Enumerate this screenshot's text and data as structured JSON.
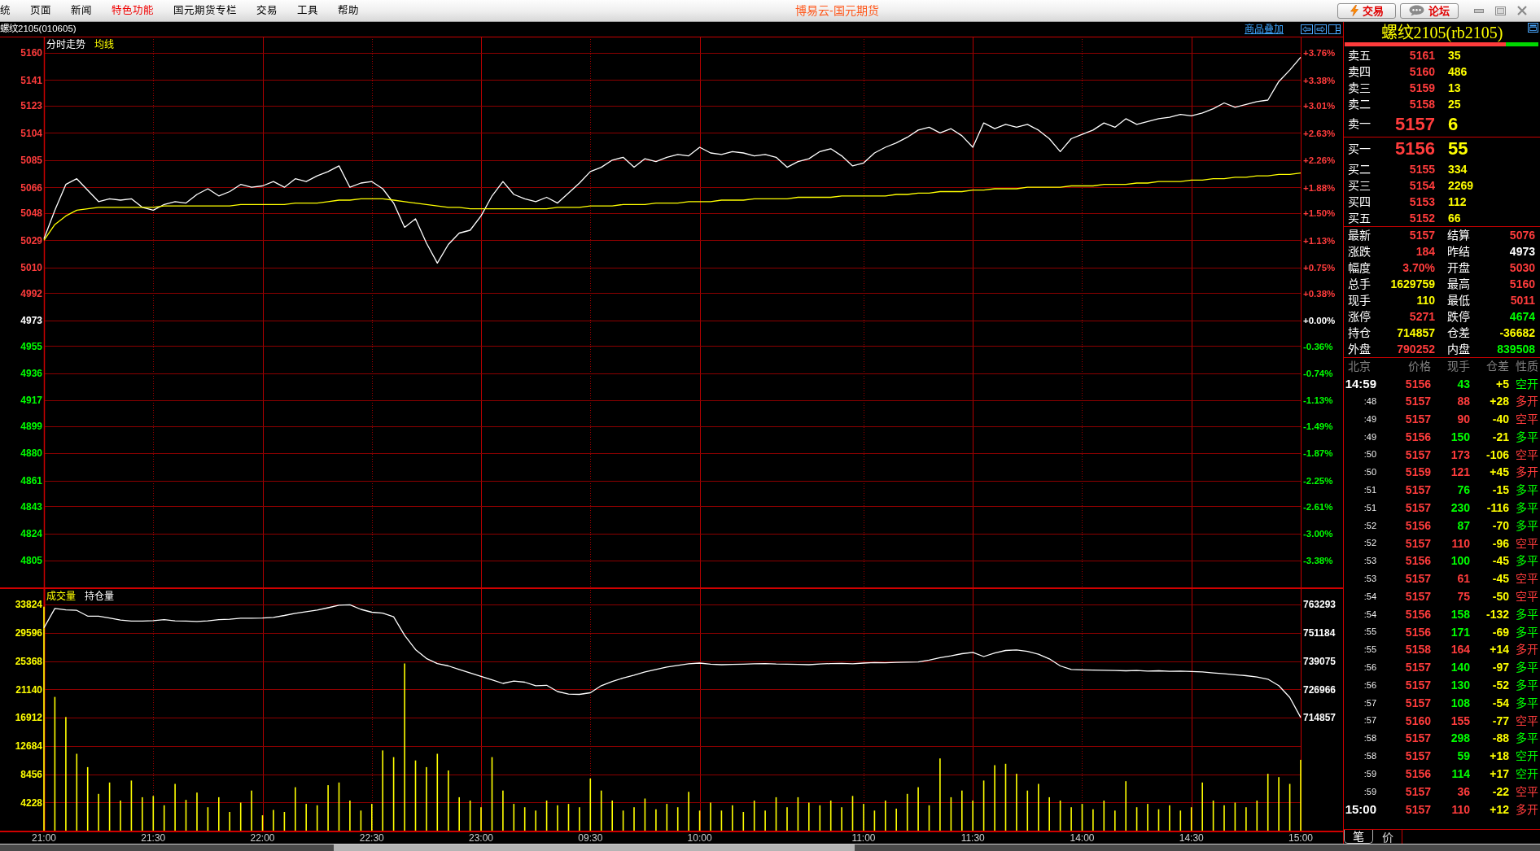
{
  "menu_bar": {
    "items": [
      {
        "label": "统",
        "highlighted": false
      },
      {
        "label": "页面",
        "highlighted": false
      },
      {
        "label": "新闻",
        "highlighted": false
      },
      {
        "label": "特色功能",
        "highlighted": true
      },
      {
        "label": "国元期货专栏",
        "highlighted": false
      },
      {
        "label": "交易",
        "highlighted": false
      },
      {
        "label": "工具",
        "highlighted": false
      },
      {
        "label": "帮助",
        "highlighted": false
      }
    ],
    "title": "博易云-国元期货",
    "buttons": [
      {
        "label": "交易",
        "kind": "trade"
      },
      {
        "label": "论坛",
        "kind": "forum"
      }
    ]
  },
  "chart_header": {
    "symbol": "螺纹2105(010605)",
    "overlay_link": "商品叠加"
  },
  "price_chart": {
    "right_axis_labels": [
      "+3.76%",
      "+3.38%",
      "+3.01%",
      "+2.63%",
      "+2.26%",
      "+1.88%",
      "+1.50%",
      "+1.13%",
      "+0.75%",
      "+0.38%",
      "+0.00%",
      "-0.36%",
      "-0.74%",
      "-1.13%",
      "-1.49%",
      "-1.87%",
      "-2.25%",
      "-2.61%",
      "-3.00%",
      "-3.38%"
    ],
    "chart_data": {
      "type": "line",
      "grid": true,
      "ylim": [
        4805,
        5160
      ],
      "yticks": [
        5160,
        5141,
        5123,
        5104,
        5085,
        5066,
        5048,
        5029,
        5010,
        4992,
        4973,
        4955,
        4936,
        4917,
        4899,
        4880,
        4861,
        4843,
        4824,
        4805
      ],
      "series": [
        {
          "name": "分时走势",
          "color": "#ffffff",
          "values": [
            5030,
            5050,
            5068,
            5072,
            5064,
            5056,
            5058,
            5057,
            5058,
            5052,
            5050,
            5054,
            5056,
            5055,
            5061,
            5065,
            5060,
            5063,
            5068,
            5066,
            5067,
            5070,
            5066,
            5072,
            5070,
            5074,
            5077,
            5081,
            5066,
            5069,
            5070,
            5065,
            5055,
            5038,
            5044,
            5027,
            5013,
            5026,
            5034,
            5036,
            5046,
            5060,
            5070,
            5061,
            5058,
            5056,
            5059,
            5055,
            5062,
            5069,
            5077,
            5080,
            5085,
            5087,
            5080,
            5086,
            5084,
            5087,
            5089,
            5088,
            5094,
            5090,
            5089,
            5091,
            5090,
            5088,
            5089,
            5087,
            5080,
            5084,
            5086,
            5091,
            5093,
            5088,
            5081,
            5083,
            5090,
            5094,
            5097,
            5101,
            5106,
            5108,
            5104,
            5107,
            5102,
            5094,
            5111,
            5107,
            5110,
            5108,
            5110,
            5106,
            5100,
            5091,
            5100,
            5103,
            5106,
            5111,
            5108,
            5114,
            5110,
            5112,
            5114,
            5115,
            5117,
            5116,
            5118,
            5121,
            5125,
            5122,
            5124,
            5126,
            5127,
            5140,
            5148,
            5157
          ]
        },
        {
          "name": "均线",
          "color": "#ffff00",
          "values": [
            5029,
            5040,
            5046,
            5050,
            5051,
            5052,
            5052,
            5052,
            5052,
            5052,
            5052,
            5053,
            5053,
            5053,
            5053,
            5053,
            5053,
            5053,
            5054,
            5054,
            5054,
            5054,
            5054,
            5055,
            5055,
            5055,
            5056,
            5057,
            5057,
            5058,
            5058,
            5058,
            5057,
            5056,
            5055,
            5054,
            5053,
            5052,
            5052,
            5051,
            5051,
            5051,
            5051,
            5051,
            5051,
            5051,
            5051,
            5052,
            5052,
            5052,
            5053,
            5053,
            5053,
            5054,
            5054,
            5054,
            5055,
            5055,
            5055,
            5056,
            5056,
            5056,
            5057,
            5057,
            5057,
            5058,
            5058,
            5058,
            5058,
            5059,
            5059,
            5059,
            5059,
            5060,
            5060,
            5060,
            5060,
            5060,
            5061,
            5061,
            5062,
            5062,
            5063,
            5063,
            5063,
            5064,
            5064,
            5065,
            5065,
            5065,
            5066,
            5066,
            5066,
            5066,
            5067,
            5067,
            5067,
            5068,
            5068,
            5068,
            5069,
            5069,
            5070,
            5070,
            5070,
            5071,
            5071,
            5072,
            5072,
            5073,
            5073,
            5074,
            5074,
            5075,
            5075,
            5076
          ]
        }
      ]
    }
  },
  "volume_chart": {
    "chart_data": {
      "type": "bar",
      "grid": true,
      "categories": [
        "21:00",
        null,
        null,
        null,
        null,
        null,
        null,
        null,
        null,
        null,
        "21:30",
        null,
        null,
        null,
        null,
        null,
        null,
        null,
        null,
        null,
        "22:00",
        null,
        null,
        null,
        null,
        null,
        null,
        null,
        null,
        null,
        "22:30",
        null,
        null,
        null,
        null,
        null,
        null,
        null,
        null,
        null,
        "23:00",
        null,
        null,
        null,
        null,
        null,
        null,
        null,
        null,
        null,
        "09:30",
        null,
        null,
        null,
        null,
        null,
        null,
        null,
        null,
        null,
        "10:00",
        null,
        null,
        null,
        null,
        null,
        null,
        null,
        null,
        null,
        null,
        null,
        null,
        null,
        null,
        "11:00",
        null,
        null,
        null,
        null,
        null,
        null,
        null,
        null,
        null,
        "11:30",
        null,
        null,
        null,
        null,
        null,
        null,
        null,
        null,
        null,
        "14:00",
        null,
        null,
        null,
        null,
        null,
        null,
        null,
        null,
        null,
        "14:30",
        null,
        null,
        null,
        null,
        null,
        null,
        null,
        null,
        null,
        "15:00"
      ],
      "ylim": [
        0,
        33824
      ],
      "yticks": [
        33824,
        29596,
        25368,
        21140,
        16912,
        12684,
        8456,
        4228
      ],
      "y2lim": [
        666421,
        763293
      ],
      "y2ticks": [
        763293,
        751184,
        739075,
        726966,
        714857
      ],
      "series": [
        {
          "name": "成交量",
          "color": "#ffff00",
          "values": [
            33500,
            20000,
            17000,
            11500,
            9500,
            5500,
            7200,
            4500,
            7500,
            5000,
            5200,
            3800,
            7000,
            4600,
            5700,
            3500,
            5000,
            2800,
            4200,
            6000,
            2300,
            3100,
            2800,
            6500,
            4000,
            3800,
            6800,
            7200,
            4500,
            3000,
            4000,
            12000,
            11000,
            25000,
            10500,
            9500,
            11500,
            9000,
            5000,
            4500,
            3500,
            11000,
            6000,
            4000,
            3500,
            3000,
            4500,
            3800,
            4000,
            3500,
            7800,
            6000,
            4500,
            3000,
            3500,
            4800,
            3200,
            4000,
            3500,
            5800,
            3000,
            4200,
            3000,
            3800,
            2800,
            4500,
            3000,
            5000,
            3500,
            5000,
            4200,
            3800,
            4500,
            3500,
            5200,
            4000,
            3000,
            4500,
            3300,
            5500,
            6500,
            3800,
            10800,
            5000,
            6000,
            4500,
            7500,
            9800,
            10000,
            8500,
            6000,
            7000,
            5000,
            4500,
            3500,
            4000,
            3200,
            4500,
            3000,
            7400,
            3500,
            4000,
            3200,
            3800,
            3000,
            3500,
            7200,
            4500,
            3800,
            4200,
            3500,
            4500,
            8500,
            8000,
            7000,
            10600
          ]
        },
        {
          "name": "持仓量",
          "color": "#ffffff",
          "type": "line",
          "axis": "y2",
          "values": [
            753300,
            761600,
            761000,
            760800,
            758300,
            758300,
            757500,
            756600,
            756200,
            756200,
            756400,
            756800,
            756300,
            756200,
            756000,
            756300,
            756800,
            757000,
            757400,
            757400,
            757500,
            757800,
            758600,
            759500,
            760200,
            760900,
            761900,
            763000,
            763200,
            761200,
            760000,
            759600,
            758000,
            750100,
            744000,
            740200,
            738000,
            737000,
            735500,
            734000,
            732500,
            731000,
            729500,
            730500,
            730000,
            728500,
            728700,
            726000,
            724900,
            724800,
            725500,
            728500,
            730300,
            731800,
            733000,
            734400,
            735500,
            736500,
            737200,
            737900,
            738200,
            737700,
            737500,
            737600,
            737700,
            737900,
            738000,
            737800,
            737700,
            737600,
            737500,
            737800,
            738000,
            738100,
            737900,
            738200,
            738400,
            738300,
            738500,
            738600,
            738700,
            739500,
            740500,
            741300,
            742200,
            742800,
            741000,
            742500,
            743600,
            743800,
            743200,
            742000,
            740000,
            737000,
            735500,
            735300,
            735200,
            735100,
            735000,
            734900,
            735000,
            734800,
            734900,
            734700,
            734800,
            734600,
            734400,
            734000,
            733600,
            733200,
            732800,
            732200,
            731300,
            728500,
            723500,
            714900
          ]
        }
      ]
    }
  },
  "quote_panel": {
    "title": "螺纹2105(rb2105)",
    "bid_ratio": {
      "level": 0.83
    },
    "asks": [
      {
        "label": "卖五",
        "price": "5161",
        "volume": "35",
        "kind": "level"
      },
      {
        "label": "卖四",
        "price": "5160",
        "volume": "486",
        "kind": "level"
      },
      {
        "label": "卖三",
        "price": "5159",
        "volume": "13",
        "kind": "level"
      },
      {
        "label": "卖二",
        "price": "5158",
        "volume": "25",
        "kind": "level"
      },
      {
        "label": "卖一",
        "price": "5157",
        "volume": "6",
        "kind": "best"
      }
    ],
    "bids": [
      {
        "label": "买一",
        "price": "5156",
        "volume": "55",
        "kind": "best"
      },
      {
        "label": "买二",
        "price": "5155",
        "volume": "334",
        "kind": "level"
      },
      {
        "label": "买三",
        "price": "5154",
        "volume": "2269",
        "kind": "level"
      },
      {
        "label": "买四",
        "price": "5153",
        "volume": "112",
        "kind": "level"
      },
      {
        "label": "买五",
        "price": "5152",
        "volume": "66",
        "kind": "level"
      }
    ],
    "stats": [
      {
        "label": "最新",
        "value": "5157",
        "color": "#ff3c3c"
      },
      {
        "label": "结算",
        "value": "5076",
        "color": "#ff3c3c"
      },
      {
        "label": "涨跌",
        "value": "184",
        "color": "#ff3c3c"
      },
      {
        "label": "昨结",
        "value": "4973",
        "color": "#ffffff"
      },
      {
        "label": "幅度",
        "value": "3.70%",
        "color": "#ff3c3c"
      },
      {
        "label": "开盘",
        "value": "5030",
        "color": "#ff3c3c"
      },
      {
        "label": "总手",
        "value": "1629759",
        "color": "#ffff00"
      },
      {
        "label": "最高",
        "value": "5160",
        "color": "#ff3c3c"
      },
      {
        "label": "现手",
        "value": "110",
        "color": "#ffff00"
      },
      {
        "label": "最低",
        "value": "5011",
        "color": "#ff3c3c"
      },
      {
        "label": "涨停",
        "value": "5271",
        "color": "#ff3c3c"
      },
      {
        "label": "跌停",
        "value": "4674",
        "color": "#00ff00"
      },
      {
        "label": "持仓",
        "value": "714857",
        "color": "#ffff00"
      },
      {
        "label": "仓差",
        "value": "-36682",
        "color": "#ffff00"
      },
      {
        "label": "外盘",
        "value": "790252",
        "color": "#ff3c3c"
      },
      {
        "label": "内盘",
        "value": "839508",
        "color": "#00ff00"
      }
    ],
    "trades": {
      "columns": [
        "北京",
        "价格",
        "现手",
        "仓差",
        "性质"
      ],
      "rows": [
        {
          "time": "14:59",
          "kind": "hour",
          "price": "5156",
          "volume": "43",
          "change": "+5",
          "nature": "空开",
          "color": "#00ff00"
        },
        {
          "time": ":48",
          "kind": "minute",
          "price": "5157",
          "volume": "88",
          "change": "+28",
          "nature": "多开",
          "color": "#ff3c3c"
        },
        {
          "time": ":49",
          "kind": "minute",
          "price": "5157",
          "volume": "90",
          "change": "-40",
          "nature": "空平",
          "color": "#ff3c3c"
        },
        {
          "time": ":49",
          "kind": "minute",
          "price": "5156",
          "volume": "150",
          "change": "-21",
          "nature": "多平",
          "color": "#00ff00"
        },
        {
          "time": ":50",
          "kind": "minute",
          "price": "5157",
          "volume": "173",
          "change": "-106",
          "nature": "空平",
          "color": "#ff3c3c"
        },
        {
          "time": ":50",
          "kind": "minute",
          "price": "5159",
          "volume": "121",
          "change": "+45",
          "nature": "多开",
          "color": "#ff3c3c"
        },
        {
          "time": ":51",
          "kind": "minute",
          "price": "5157",
          "volume": "76",
          "change": "-15",
          "nature": "多平",
          "color": "#00ff00"
        },
        {
          "time": ":51",
          "kind": "minute",
          "price": "5157",
          "volume": "230",
          "change": "-116",
          "nature": "多平",
          "color": "#00ff00"
        },
        {
          "time": ":52",
          "kind": "minute",
          "price": "5156",
          "volume": "87",
          "change": "-70",
          "nature": "多平",
          "color": "#00ff00"
        },
        {
          "time": ":52",
          "kind": "minute",
          "price": "5157",
          "volume": "110",
          "change": "-96",
          "nature": "空平",
          "color": "#ff3c3c"
        },
        {
          "time": ":53",
          "kind": "minute",
          "price": "5156",
          "volume": "100",
          "change": "-45",
          "nature": "多平",
          "color": "#00ff00"
        },
        {
          "time": ":53",
          "kind": "minute",
          "price": "5157",
          "volume": "61",
          "change": "-45",
          "nature": "空平",
          "color": "#ff3c3c"
        },
        {
          "time": ":54",
          "kind": "minute",
          "price": "5157",
          "volume": "75",
          "change": "-50",
          "nature": "空平",
          "color": "#ff3c3c"
        },
        {
          "time": ":54",
          "kind": "minute",
          "price": "5156",
          "volume": "158",
          "change": "-132",
          "nature": "多平",
          "color": "#00ff00"
        },
        {
          "time": ":55",
          "kind": "minute",
          "price": "5156",
          "volume": "171",
          "change": "-69",
          "nature": "多平",
          "color": "#00ff00"
        },
        {
          "time": ":55",
          "kind": "minute",
          "price": "5158",
          "volume": "164",
          "change": "+14",
          "nature": "多开",
          "color": "#ff3c3c"
        },
        {
          "time": ":56",
          "kind": "minute",
          "price": "5157",
          "volume": "140",
          "change": "-97",
          "nature": "多平",
          "color": "#00ff00"
        },
        {
          "time": ":56",
          "kind": "minute",
          "price": "5157",
          "volume": "130",
          "change": "-52",
          "nature": "多平",
          "color": "#00ff00"
        },
        {
          "time": ":57",
          "kind": "minute",
          "price": "5157",
          "volume": "108",
          "change": "-54",
          "nature": "多平",
          "color": "#00ff00"
        },
        {
          "time": ":57",
          "kind": "minute",
          "price": "5160",
          "volume": "155",
          "change": "-77",
          "nature": "空平",
          "color": "#ff3c3c"
        },
        {
          "time": ":58",
          "kind": "minute",
          "price": "5157",
          "volume": "298",
          "change": "-88",
          "nature": "多平",
          "color": "#00ff00"
        },
        {
          "time": ":58",
          "kind": "minute",
          "price": "5157",
          "volume": "59",
          "change": "+18",
          "nature": "空开",
          "color": "#00ff00"
        },
        {
          "time": ":59",
          "kind": "minute",
          "price": "5156",
          "volume": "114",
          "change": "+17",
          "nature": "空开",
          "color": "#00ff00"
        },
        {
          "time": ":59",
          "kind": "minute",
          "price": "5157",
          "volume": "36",
          "change": "-22",
          "nature": "空平",
          "color": "#ff3c3c"
        },
        {
          "time": "15:00",
          "kind": "hour",
          "price": "5157",
          "volume": "110",
          "change": "+12",
          "nature": "多开",
          "color": "#ff3c3c"
        }
      ]
    },
    "tabs": [
      {
        "label": "笔",
        "selected": true
      },
      {
        "label": "价",
        "selected": false
      }
    ]
  }
}
